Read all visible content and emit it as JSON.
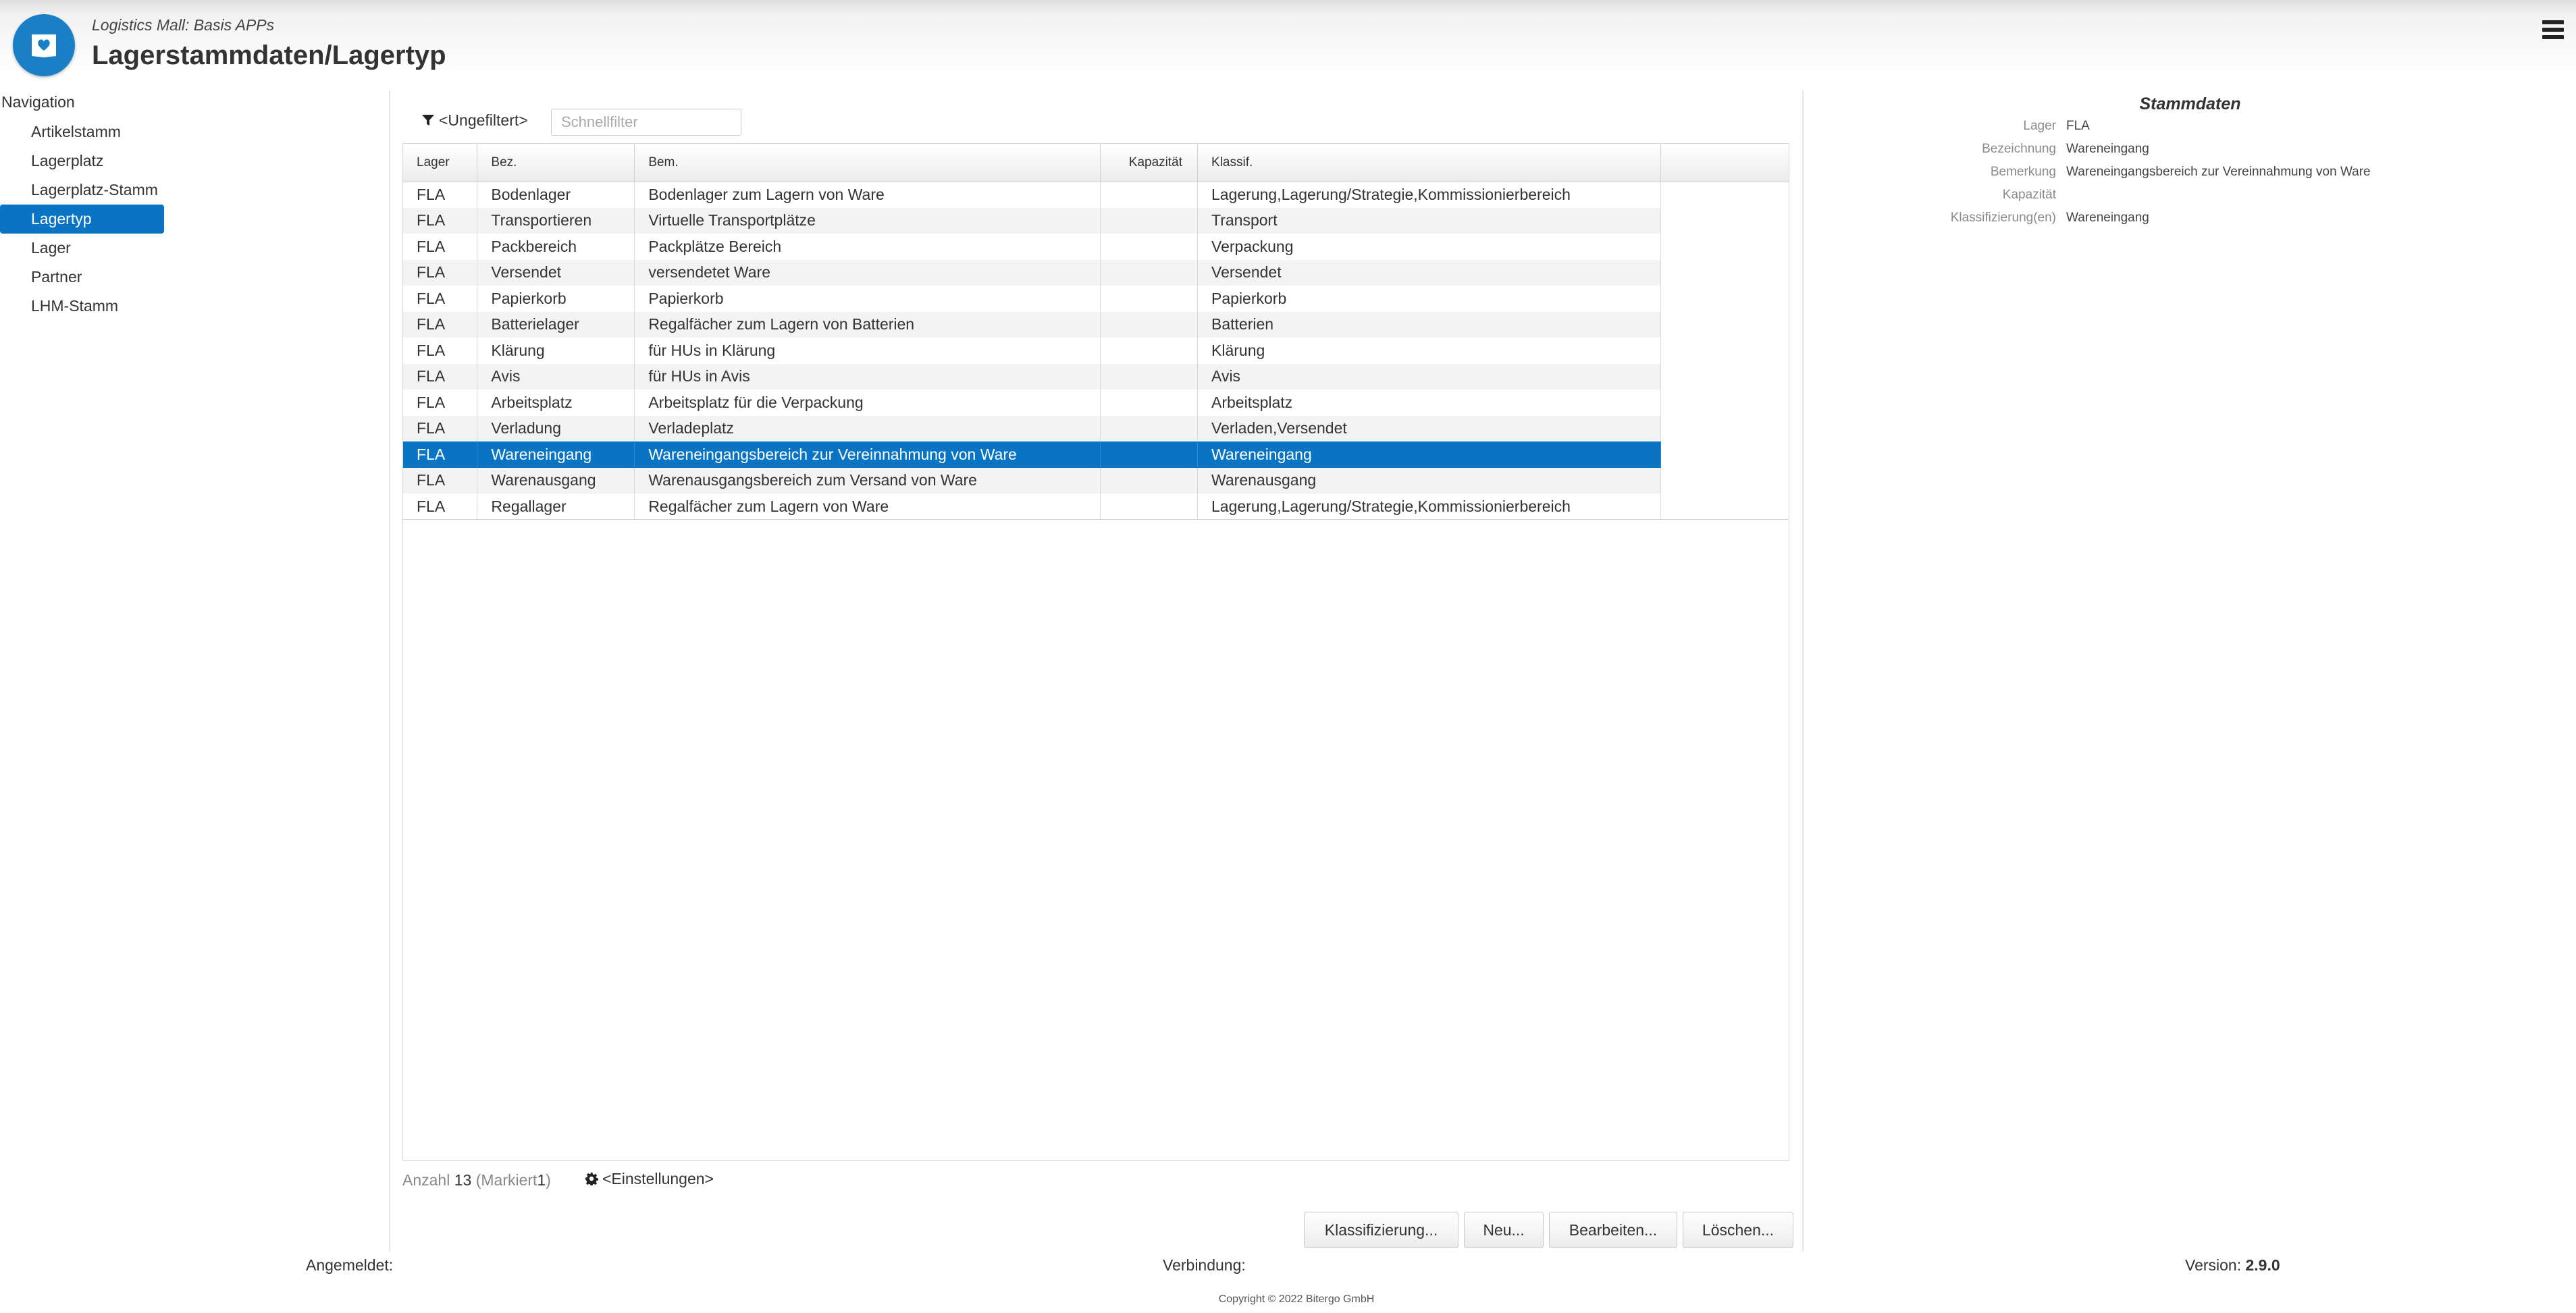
{
  "app": {
    "subtitle": "Logistics Mall: Basis APPs",
    "title": "Lagerstammdaten/Lagertyp"
  },
  "navigation": {
    "heading": "Navigation",
    "items": [
      {
        "label": "Artikelstamm"
      },
      {
        "label": "Lagerplatz"
      },
      {
        "label": "Lagerplatz-Stamm"
      },
      {
        "label": "Lagertyp",
        "active": true
      },
      {
        "label": "Lager"
      },
      {
        "label": "Partner"
      },
      {
        "label": "LHM-Stamm"
      }
    ]
  },
  "filter": {
    "label": "<Ungefiltert>",
    "placeholder": "Schnellfilter",
    "value": ""
  },
  "table": {
    "columns": [
      "Lager",
      "Bez.",
      "Bem.",
      "Kapazität",
      "Klassif."
    ],
    "rows": [
      [
        "FLA",
        "Bodenlager",
        "Bodenlager zum Lagern von Ware",
        "",
        "Lagerung,Lagerung/Strategie,Kommissionierbereich"
      ],
      [
        "FLA",
        "Transportieren",
        "Virtuelle Transportplätze",
        "",
        "Transport"
      ],
      [
        "FLA",
        "Packbereich",
        "Packplätze Bereich",
        "",
        "Verpackung"
      ],
      [
        "FLA",
        "Versendet",
        "versendetet Ware",
        "",
        "Versendet"
      ],
      [
        "FLA",
        "Papierkorb",
        "Papierkorb",
        "",
        "Papierkorb"
      ],
      [
        "FLA",
        "Batterielager",
        "Regalfächer zum Lagern von Batterien",
        "",
        "Batterien"
      ],
      [
        "FLA",
        "Klärung",
        "für HUs in Klärung",
        "",
        "Klärung"
      ],
      [
        "FLA",
        "Avis",
        "für HUs in Avis",
        "",
        "Avis"
      ],
      [
        "FLA",
        "Arbeitsplatz",
        "Arbeitsplatz für die Verpackung",
        "",
        "Arbeitsplatz"
      ],
      [
        "FLA",
        "Verladung",
        "Verladeplatz",
        "",
        "Verladen,Versendet"
      ],
      [
        "FLA",
        "Wareneingang",
        "Wareneingangsbereich zur Vereinnahmung von Ware",
        "",
        "Wareneingang"
      ],
      [
        "FLA",
        "Warenausgang",
        "Warenausgangsbereich zum Versand von Ware",
        "",
        "Warenausgang"
      ],
      [
        "FLA",
        "Regallager",
        "Regalfächer zum Lagern von Ware",
        "",
        "Lagerung,Lagerung/Strategie,Kommissionierbereich"
      ]
    ],
    "selected_index": 10
  },
  "status": {
    "count_label": "Anzahl",
    "count": "13",
    "marked_open": "(Markiert",
    "marked": "1",
    "marked_close": ")",
    "settings_label": "<Einstellungen>"
  },
  "buttons": {
    "classify": "Klassifizierung...",
    "new": "Neu...",
    "edit": "Bearbeiten...",
    "delete": "Löschen..."
  },
  "detail": {
    "title": "Stammdaten",
    "fields": [
      {
        "label": "Lager",
        "value": "FLA"
      },
      {
        "label": "Bezeichnung",
        "value": "Wareneingang"
      },
      {
        "label": "Bemerkung",
        "value": "Wareneingangsbereich zur Vereinnahmung von Ware"
      },
      {
        "label": "Kapazität",
        "value": ""
      },
      {
        "label": "Klassifizierung(en)",
        "value": "Wareneingang"
      }
    ]
  },
  "footer": {
    "logged_in_label": "Angemeldet:",
    "connection_label": "Verbindung:",
    "version_label": "Version:",
    "version": "2.9.0",
    "copyright": "Copyright © 2022 Bitergo GmbH"
  },
  "colors": {
    "accent": "#0a74c4",
    "logo": "#1a7fc7"
  }
}
